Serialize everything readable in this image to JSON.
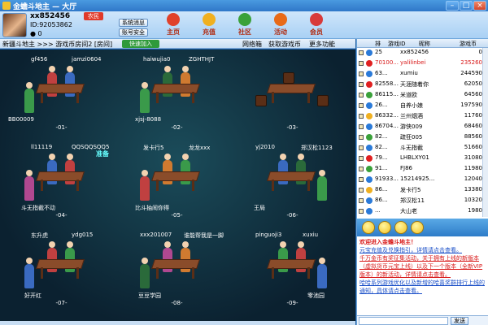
{
  "window": {
    "title": "金蟾斗地主 — 大厅"
  },
  "user": {
    "name": "xx852456",
    "id_text": "ID:92053862",
    "beans": "0",
    "level": "农民"
  },
  "buttons": {
    "messages": "系统消息",
    "safe": "账号安全"
  },
  "nav": [
    {
      "label": "主页",
      "color": "#e0412a"
    },
    {
      "label": "充值",
      "color": "#f0b020"
    },
    {
      "label": "社区",
      "color": "#3aa13a"
    },
    {
      "label": "活动",
      "color": "#e86a18"
    },
    {
      "label": "会员",
      "color": "#d83a3a"
    }
  ],
  "menustrip": {
    "crumb": "新疆斗地主 >>> 游戏币房间2 [房间]",
    "quickjoin": "快速加入",
    "items": [
      "网络箱",
      "获取游戏币",
      "更多功能"
    ]
  },
  "tables": [
    {
      "num": "-01-",
      "players": [
        "gf456",
        "jamzi0604",
        "BB00009",
        ""
      ]
    },
    {
      "num": "-02-",
      "players": [
        "haiwujia0",
        "ZGHTHJT",
        "xjsj-8088",
        ""
      ]
    },
    {
      "num": "-03-",
      "players": [
        "",
        "",
        "",
        ""
      ]
    },
    {
      "num": "-04-",
      "players": [
        "ll11119",
        "QQSQQSQQ5",
        "斗无指截不动",
        ""
      ]
    },
    {
      "num": "-05-",
      "players": [
        "发卡行5",
        "龙龙xxx",
        "比斗抽闹你得",
        ""
      ]
    },
    {
      "num": "-06-",
      "players": [
        "yj2010",
        "郑汉松1123",
        "王局",
        ""
      ]
    },
    {
      "num": "-07-",
      "players": [
        "东升虎",
        "ydg015",
        "好开红",
        ""
      ]
    },
    {
      "num": "-08-",
      "players": [
        "xxx201007",
        "谁能帮我是一脚",
        "豆豆学园",
        ""
      ]
    },
    {
      "num": "-09-",
      "players": [
        "pinguoji3",
        "xuxiu",
        "零池园",
        ""
      ]
    }
  ],
  "ready_text": "准备",
  "playerlist": {
    "headers": [
      "排",
      "游戏ID",
      "昵称",
      "游戏币"
    ],
    "rows": [
      {
        "rank": "25",
        "nick": "xx852456",
        "score": "0",
        "red": false,
        "icon": "#2a7ad8"
      },
      {
        "rank": "70100...",
        "nick": "yalilinbei",
        "score": "235260",
        "red": true,
        "icon": "#e02020"
      },
      {
        "rank": "63...",
        "nick": "xumiu",
        "score": "244590",
        "red": false,
        "icon": "#2a7ad8"
      },
      {
        "rank": "82558...",
        "nick": "天涯随着你",
        "score": "62050",
        "red": false,
        "icon": "#e02020"
      },
      {
        "rank": "86115...",
        "nick": "米道欧",
        "score": "64560",
        "red": false,
        "icon": "#3aa13a"
      },
      {
        "rank": "26...",
        "nick": "自养小娘",
        "score": "197590",
        "red": false,
        "icon": "#2a7ad8"
      },
      {
        "rank": "86332...",
        "nick": "兰州烟酒",
        "score": "11760",
        "red": false,
        "icon": "#f0b020"
      },
      {
        "rank": "86704...",
        "nick": "游侠009",
        "score": "68460",
        "red": false,
        "icon": "#2a7ad8"
      },
      {
        "rank": "82...",
        "nick": "疏狂005",
        "score": "88560",
        "red": false,
        "icon": "#3aa13a"
      },
      {
        "rank": "82...",
        "nick": "斗无指截",
        "score": "51660",
        "red": false,
        "icon": "#2a7ad8"
      },
      {
        "rank": "79...",
        "nick": "LHBLXY01",
        "score": "31080",
        "red": false,
        "icon": "#e02020"
      },
      {
        "rank": "91...",
        "nick": "FJ86",
        "score": "11980",
        "red": false,
        "icon": "#3aa13a"
      },
      {
        "rank": "91933...",
        "nick": "15214925...",
        "score": "12040",
        "red": false,
        "icon": "#2a7ad8"
      },
      {
        "rank": "86...",
        "nick": "发卡行5",
        "score": "13380",
        "red": false,
        "icon": "#f0b020"
      },
      {
        "rank": "86...",
        "nick": "郑汉松11",
        "score": "10320",
        "red": false,
        "icon": "#2a7ad8"
      },
      {
        "rank": "...",
        "nick": "大山老",
        "score": "1980",
        "red": false,
        "icon": "#2a7ad8"
      }
    ]
  },
  "chat": [
    {
      "cls": "c1",
      "text": "欢迎进入金蟾斗地主！"
    },
    {
      "cls": "c2",
      "text": "元宝充值及兑换指引，详情请点击查看。"
    },
    {
      "cls": "c3",
      "text": "千万金币有奖征集活动，关于拥有上线的新版本（虚拟货币元宝上线）以及下一个版本（全新VIP版本）的新活动，详情请点击查看。"
    },
    {
      "cls": "c2",
      "text": "哈哈系列游戏优化以及新增的哈喜奖群排行上线的通知，具体请点击查看。"
    }
  ],
  "input": {
    "placeholder": "",
    "send": "发送"
  }
}
